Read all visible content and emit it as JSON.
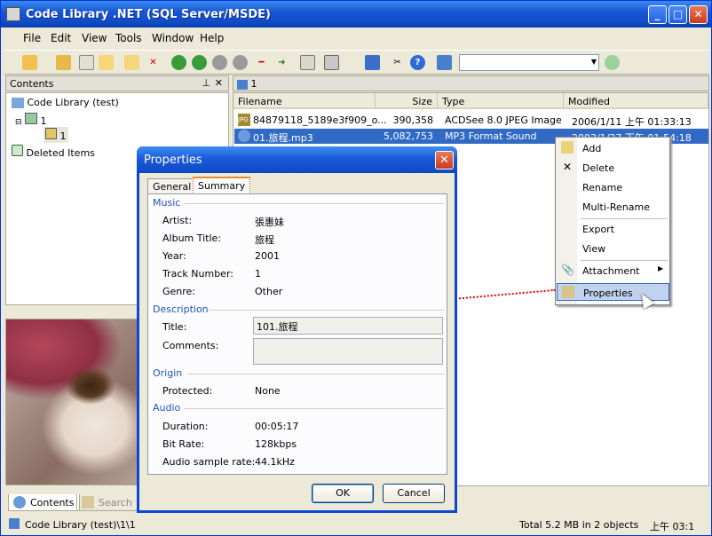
{
  "window": {
    "title": "Code Library .NET (SQL Server/MSDE)",
    "min": "_",
    "max": "□",
    "close": "✕"
  },
  "menu": [
    "File",
    "Edit",
    "View",
    "Tools",
    "Window",
    "Help"
  ],
  "left_panel": {
    "header": "Contents",
    "tree": [
      {
        "label": "Code Library (test)"
      },
      {
        "label": "1"
      },
      {
        "label": "1"
      },
      {
        "label": "Deleted Items"
      }
    ],
    "tabs": [
      "Contents",
      "Search"
    ]
  },
  "right_panel": {
    "header": "1",
    "columns": [
      "Filename",
      "Size",
      "Type",
      "Modified"
    ],
    "rows": [
      {
        "filename": "84879118_5189e3f909_o...",
        "size": "390,358",
        "type": "ACDSee 8.0 JPEG Image",
        "modified": "2006/1/11 上午 01:33:13"
      },
      {
        "filename": "01.旅程.mp3",
        "size": "5,082,753",
        "type": "MP3 Format Sound",
        "modified": "2003/1/27 下午 01:54:18"
      }
    ]
  },
  "context_menu": {
    "items": [
      "Add",
      "Delete",
      "Rename",
      "Multi-Rename",
      "Export",
      "View",
      "Attachment",
      "Properties"
    ],
    "submenu_arrow": "▶"
  },
  "dialog": {
    "title": "Properties",
    "close": "✕",
    "tabs": [
      "General",
      "Summary"
    ],
    "sections": {
      "music": {
        "title": "Music",
        "rows": [
          {
            "label": "Artist:",
            "value": "張惠妹"
          },
          {
            "label": "Album Title:",
            "value": "旅程"
          },
          {
            "label": "Year:",
            "value": "2001"
          },
          {
            "label": "Track Number:",
            "value": "1"
          },
          {
            "label": "Genre:",
            "value": "Other"
          }
        ]
      },
      "description": {
        "title": "Description",
        "title_label": "Title:",
        "title_value": "101.旅程",
        "comments_label": "Comments:",
        "comments_value": ""
      },
      "origin": {
        "title": "Origin",
        "rows": [
          {
            "label": "Protected:",
            "value": "None"
          }
        ]
      },
      "audio": {
        "title": "Audio",
        "rows": [
          {
            "label": "Duration:",
            "value": "00:05:17"
          },
          {
            "label": "Bit Rate:",
            "value": "128kbps"
          },
          {
            "label": "Audio sample rate:",
            "value": "44.1kHz"
          }
        ]
      }
    },
    "ok": "OK",
    "cancel": "Cancel"
  },
  "status": {
    "path": "Code Library (test)\\1\\1",
    "total": "Total 5.2 MB in 2 objects",
    "time": "上午 03:1"
  },
  "colors": {
    "accent": "#316ac5",
    "title_blue": "#0a48d4",
    "annotation_red": "#e00000"
  }
}
